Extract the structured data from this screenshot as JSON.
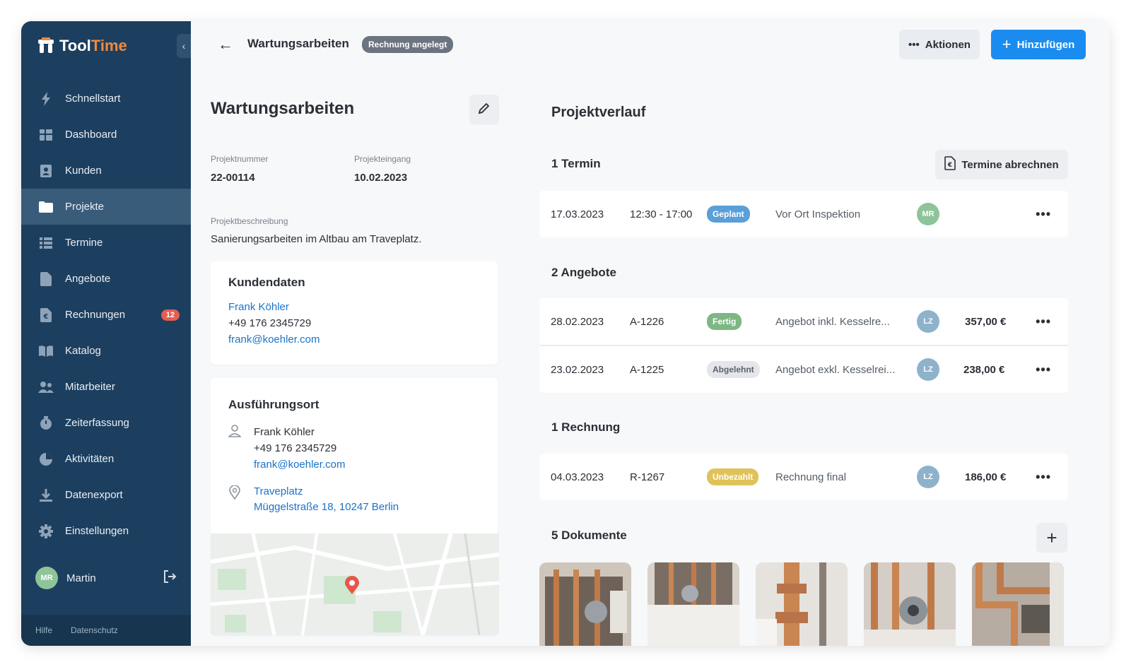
{
  "app": {
    "name_part1": "Tool",
    "name_part2": "Time"
  },
  "sidebar": {
    "items": [
      {
        "label": "Schnellstart",
        "icon": "bolt-icon"
      },
      {
        "label": "Dashboard",
        "icon": "dashboard-icon"
      },
      {
        "label": "Kunden",
        "icon": "contacts-icon"
      },
      {
        "label": "Projekte",
        "icon": "folder-icon",
        "active": true
      },
      {
        "label": "Termine",
        "icon": "list-icon"
      },
      {
        "label": "Angebote",
        "icon": "document-icon"
      },
      {
        "label": "Rechnungen",
        "icon": "invoice-icon",
        "badge": "12"
      },
      {
        "label": "Katalog",
        "icon": "book-icon"
      },
      {
        "label": "Mitarbeiter",
        "icon": "people-icon"
      },
      {
        "label": "Zeiterfassung",
        "icon": "stopwatch-icon"
      },
      {
        "label": "Aktivitäten",
        "icon": "activity-icon"
      },
      {
        "label": "Datenexport",
        "icon": "download-icon"
      },
      {
        "label": "Einstellungen",
        "icon": "gear-icon"
      }
    ],
    "user": {
      "initials": "MR",
      "name": "Martin"
    },
    "footer": {
      "help": "Hilfe",
      "privacy": "Datenschutz"
    }
  },
  "header": {
    "title": "Wartungsarbeiten",
    "status": "Rechnung angelegt",
    "actions_label": "Aktionen",
    "add_label": "Hinzufügen"
  },
  "project": {
    "title": "Wartungsarbeiten",
    "number_label": "Projektnummer",
    "number": "22-00114",
    "date_label": "Projekteingang",
    "date": "10.02.2023",
    "description_label": "Projektbeschreibung",
    "description": "Sanierungsarbeiten im Altbau am Traveplatz."
  },
  "customer": {
    "heading": "Kundendaten",
    "name": "Frank Köhler",
    "phone": "+49 176 2345729",
    "email": "frank@koehler.com"
  },
  "location": {
    "heading": "Ausführungsort",
    "name": "Frank Köhler",
    "phone": "+49 176 2345729",
    "email": "frank@koehler.com",
    "place": "Traveplatz",
    "address": "Müggelstraße 18, 10247 Berlin"
  },
  "history": {
    "title": "Projektverlauf",
    "appointments": {
      "heading": "1 Termin",
      "button": "Termine abrechnen",
      "rows": [
        {
          "date": "17.03.2023",
          "time": "12:30 - 17:00",
          "status": "Geplant",
          "status_color": "#5a9fd8",
          "text": "Vor Ort Inspektion",
          "initials": "MR",
          "avatar_color": "#8fc49a"
        }
      ]
    },
    "offers": {
      "heading": "2 Angebote",
      "rows": [
        {
          "date": "28.02.2023",
          "number": "A-1226",
          "status": "Fertig",
          "status_color": "#7cb784",
          "text": "Angebot inkl. Kesselre...",
          "initials": "LZ",
          "avatar_color": "#8fb2cc",
          "amount": "357,00 €"
        },
        {
          "date": "23.02.2023",
          "number": "A-1225",
          "status": "Abgelehnt",
          "status_color": "#e4e6e9",
          "text": "Angebot exkl. Kesselrei...",
          "initials": "LZ",
          "avatar_color": "#8fb2cc",
          "amount": "238,00 €"
        }
      ]
    },
    "invoices": {
      "heading": "1 Rechnung",
      "rows": [
        {
          "date": "04.03.2023",
          "number": "R-1267",
          "status": "Unbezahlt",
          "status_color": "#e0c25a",
          "text": "Rechnung final",
          "initials": "LZ",
          "avatar_color": "#8fb2cc",
          "amount": "186,00 €"
        }
      ]
    },
    "documents": {
      "heading": "5 Dokumente"
    }
  }
}
